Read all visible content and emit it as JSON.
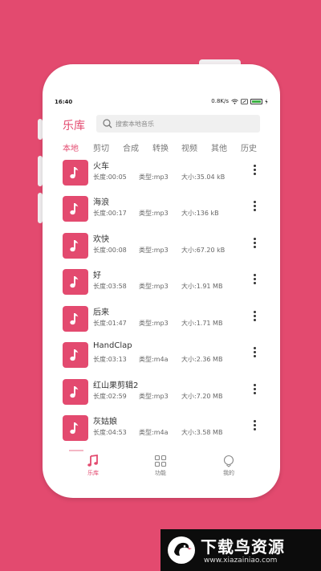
{
  "status_bar": {
    "time": "16:40",
    "speed": "0.8K/s"
  },
  "header": {
    "title": "乐库",
    "search_placeholder": "搜索本地音乐"
  },
  "tabs": [
    {
      "label": "本地",
      "active": true
    },
    {
      "label": "剪切",
      "active": false
    },
    {
      "label": "合成",
      "active": false
    },
    {
      "label": "转换",
      "active": false
    },
    {
      "label": "视频",
      "active": false
    },
    {
      "label": "其他",
      "active": false
    },
    {
      "label": "历史",
      "active": false
    }
  ],
  "songs": [
    {
      "name": "火车",
      "duration": "长度:00:05",
      "type": "类型:mp3",
      "size": "大小:35.04 kB"
    },
    {
      "name": "海浪",
      "duration": "长度:00:17",
      "type": "类型:mp3",
      "size": "大小:136 kB"
    },
    {
      "name": "欢快",
      "duration": "长度:00:08",
      "type": "类型:mp3",
      "size": "大小:67.20 kB"
    },
    {
      "name": "好",
      "duration": "长度:03:58",
      "type": "类型:mp3",
      "size": "大小:1.91 MB"
    },
    {
      "name": "后来",
      "duration": "长度:01:47",
      "type": "类型:mp3",
      "size": "大小:1.71 MB"
    },
    {
      "name": "HandClap",
      "duration": "长度:03:13",
      "type": "类型:m4a",
      "size": "大小:2.36 MB"
    },
    {
      "name": "红山果剪辑2",
      "duration": "长度:02:59",
      "type": "类型:mp3",
      "size": "大小:7.20 MB"
    },
    {
      "name": "灰姑娘",
      "duration": "长度:04:53",
      "type": "类型:m4a",
      "size": "大小:3.58 MB"
    }
  ],
  "bottom_nav": [
    {
      "label": "乐库",
      "icon": "music-note-icon",
      "active": true
    },
    {
      "label": "功能",
      "icon": "grid-icon",
      "active": false
    },
    {
      "label": "我的",
      "icon": "profile-icon",
      "active": false
    }
  ],
  "watermark": {
    "title": "下载鸟资源",
    "url": "www.xiazainiao.com"
  },
  "colors": {
    "accent": "#e34a6f",
    "background": "#e34a6f"
  }
}
